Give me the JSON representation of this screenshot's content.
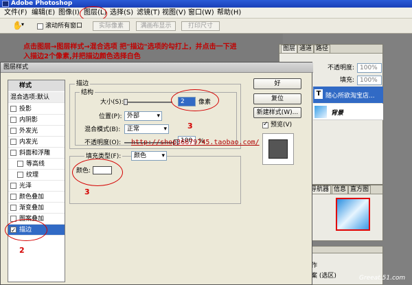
{
  "app": {
    "title": "Adobe Photoshop"
  },
  "menu": [
    "文件(F)",
    "编辑(E)",
    "图像(I)",
    "图层(L)",
    "选择(S)",
    "滤镜(T)",
    "视图(V)",
    "窗口(W)",
    "帮助(H)"
  ],
  "toolbar": {
    "scroll_all": "滚动所有窗口",
    "actual_pixels": "实际像素",
    "fit_screen": "满画布显示",
    "print_size": "打印尺寸"
  },
  "annotation": {
    "line1": "点击图层→图层样式→混合选项  把\"描边\"选项的勾打上，并点击一下进",
    "line2": "入描边2个像素,并把描边颜色选择白色",
    "n1": "1",
    "n2": "2",
    "n3a": "3",
    "n3b": "3"
  },
  "layers_panel": {
    "tabs": [
      "图层",
      "通道",
      "路径"
    ],
    "opacity_label": "不透明度:",
    "opacity_value": "100%",
    "fill_label": "填充:",
    "fill_value": "100%",
    "layers": [
      {
        "name": "随心所欲淘宝店..."
      },
      {
        "name": "背景"
      }
    ]
  },
  "nav_panel": {
    "tabs": [
      "导航器",
      "信息",
      "直方图"
    ]
  },
  "history_panel": {
    "items": [
      "作",
      "案 (选区)"
    ]
  },
  "dialog": {
    "title": "图层样式",
    "styles_header": "样式",
    "blend_item": "混合选项:默认",
    "styles": [
      {
        "label": "投影",
        "checked": false,
        "indent": false
      },
      {
        "label": "内阴影",
        "checked": false,
        "indent": false
      },
      {
        "label": "外发光",
        "checked": false,
        "indent": false
      },
      {
        "label": "内发光",
        "checked": false,
        "indent": false
      },
      {
        "label": "斜面和浮雕",
        "checked": false,
        "indent": false
      },
      {
        "label": "等高线",
        "checked": false,
        "indent": true
      },
      {
        "label": "纹理",
        "checked": false,
        "indent": true
      },
      {
        "label": "光泽",
        "checked": false,
        "indent": false
      },
      {
        "label": "颜色叠加",
        "checked": false,
        "indent": false
      },
      {
        "label": "渐变叠加",
        "checked": false,
        "indent": false
      },
      {
        "label": "图案叠加",
        "checked": false,
        "indent": false
      },
      {
        "label": "描边",
        "checked": true,
        "indent": false
      }
    ],
    "stroke_group": "描边",
    "structure_group": "结构",
    "size_label": "大小(S):",
    "size_value": "2",
    "size_unit": "像素",
    "position_label": "位置(P):",
    "position_value": "外部",
    "blend_label": "混合模式(B):",
    "blend_value": "正常",
    "opacity_label": "不透明度(O):",
    "opacity_value": "100",
    "opacity_unit": "%",
    "fill_type_label": "填充类型(F):",
    "fill_type_value": "颜色",
    "color_label": "颜色:",
    "watermark_url": "http://shop36679745.taobao.com/",
    "ok": "好",
    "reset": "复位",
    "new_style": "新建样式(W)...",
    "preview": "预览(V)"
  },
  "site_watermark": "Greeat.51.com",
  "colors": {
    "annotation_red": "#d40000",
    "selection_blue": "#316ac5",
    "title_blue": "#1940b8"
  }
}
